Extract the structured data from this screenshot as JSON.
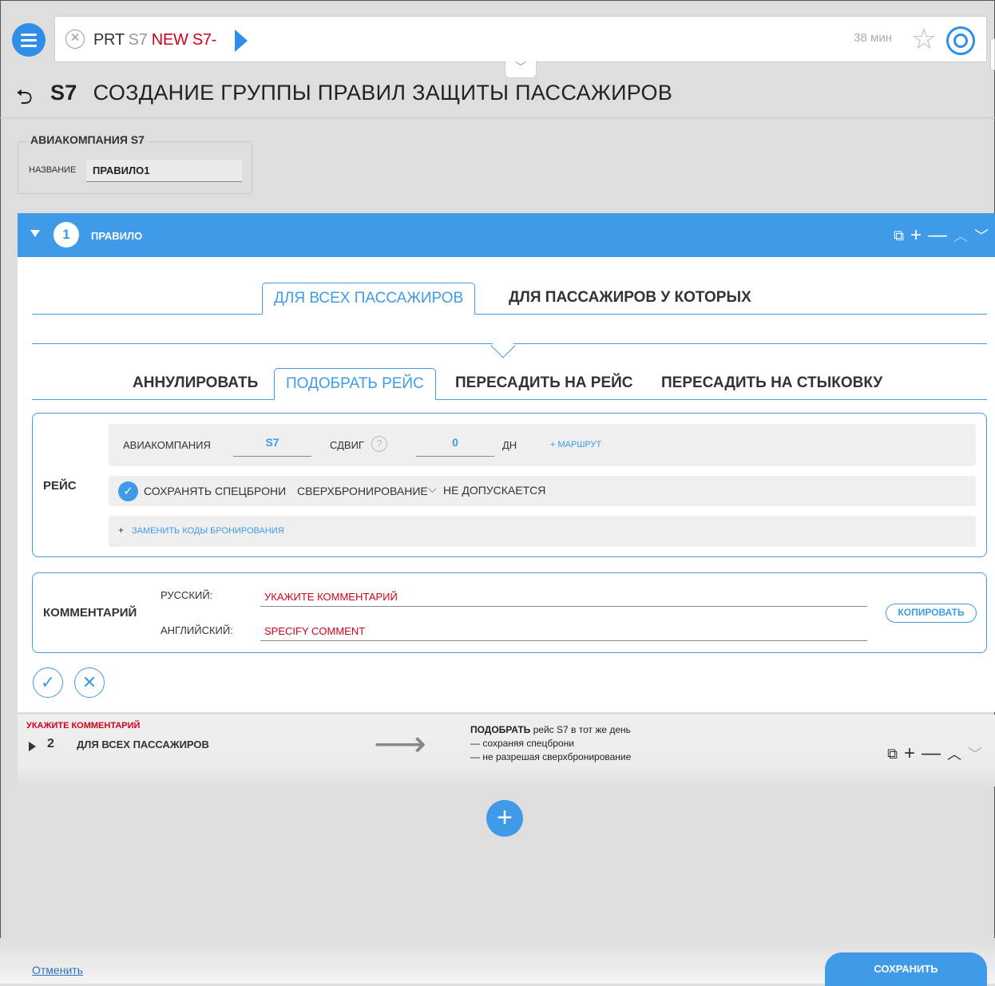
{
  "command_bar": {
    "part1": "PRT",
    "part2": "S7",
    "part3": "NEW S7-",
    "timer": "38 мин"
  },
  "page": {
    "airline_code": "S7",
    "title": "СОЗДАНИЕ ГРУППЫ ПРАВИЛ ЗАЩИТЫ ПАССАЖИРОВ"
  },
  "airline_box": {
    "legend": "АВИАКОМПАНИЯ S7",
    "name_label": "НАЗВАНИЕ",
    "name_value": "ПРАВИЛО1"
  },
  "rule1": {
    "number": "1",
    "title": "ПРАВИЛО",
    "passenger_tabs": [
      "ДЛЯ ВСЕХ ПАССАЖИРОВ",
      "ДЛЯ ПАССАЖИРОВ У КОТОРЫХ"
    ],
    "action_tabs": [
      "АННУЛИРОВАТЬ",
      "ПОДОБРАТЬ РЕЙС",
      "ПЕРЕСАДИТЬ НА РЕЙС",
      "ПЕРЕСАДИТЬ НА СТЫКОВКУ"
    ],
    "flight": {
      "label": "РЕЙС",
      "airline_label": "АВИАКОМПАНИЯ",
      "airline_value": "S7",
      "shift_label": "СДВИГ",
      "shift_help": "?",
      "shift_value": "0",
      "shift_unit": "ДН",
      "route_link": "+ МАРШРУТ",
      "keep_special": "СОХРАНЯТЬ СПЕЦБРОНИ",
      "overbooking_label": "СВЕРХБРОНИРОВАНИЕ",
      "overbooking_value": "НЕ ДОПУСКАЕТСЯ",
      "replace_codes_plus": "+",
      "replace_codes": "ЗАМЕНИТЬ КОДЫ БРОНИРОВАНИЯ"
    },
    "comment": {
      "label": "КОММЕНТАРИЙ",
      "ru_label": "РУССКИЙ:",
      "ru_placeholder": "УКАЖИТЕ КОММЕНТАРИЙ",
      "en_label": "АНГЛИЙСКИЙ:",
      "en_placeholder": "SPECIFY COMMENT",
      "copy_button": "КОПИРОВАТЬ"
    }
  },
  "rule2": {
    "warning": "УКАЖИТЕ КОММЕНТАРИЙ",
    "number": "2",
    "title": "ДЛЯ ВСЕХ ПАССАЖИРОВ",
    "desc_bold": "ПОДОБРАТЬ",
    "desc_rest": " рейс S7 в тот же день",
    "desc_line2": "— сохраняя спецброни",
    "desc_line3": "— не разрешая сверхбронирование"
  },
  "footer": {
    "cancel": "Отменить",
    "save": "СОХРАНИТЬ"
  },
  "colors": {
    "accent": "#3f9be8",
    "warning": "#d0021b",
    "background": "#dedede"
  },
  "icons": [
    "menu-icon",
    "clear-icon",
    "run-icon",
    "star-icon",
    "help-lifebuoy-icon",
    "back-icon",
    "copy-icon",
    "plus-icon",
    "minus-icon",
    "chevron-up-icon",
    "chevron-down-icon",
    "check-icon",
    "close-icon",
    "arrow-right-icon"
  ]
}
